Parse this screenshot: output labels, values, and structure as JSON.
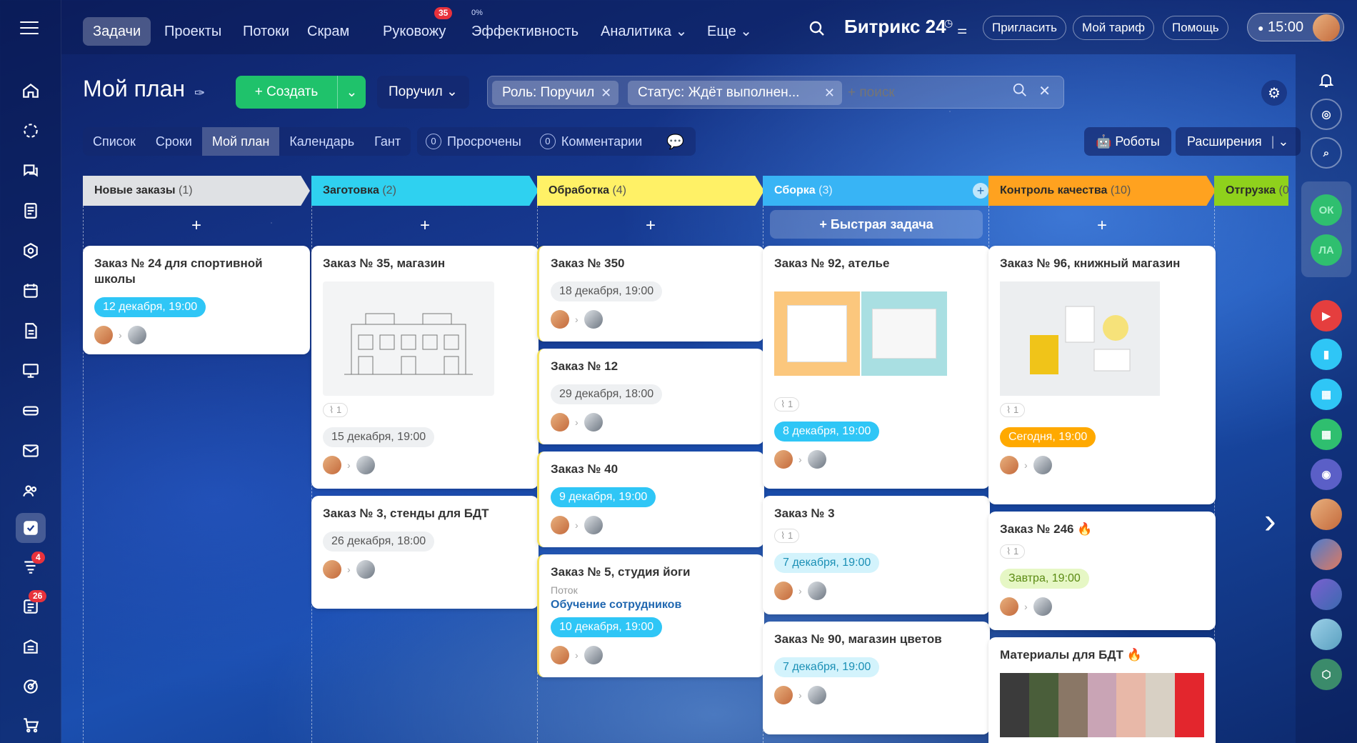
{
  "nav": {
    "items": [
      "Задачи",
      "Проекты",
      "Потоки",
      "Скрам",
      "Руковожу",
      "Эффективность",
      "Аналитика",
      "Еще"
    ],
    "badge_rukovozhu": "35",
    "efficiency_percent": "0%",
    "logo": "Битрикс 24",
    "invite": "Пригласить",
    "tariff": "Мой тариф",
    "help": "Помощь",
    "time": "15:00"
  },
  "toolbar": {
    "title": "Мой план",
    "create": "Создать",
    "role_button": "Поручил",
    "chip_role": "Роль: Поручил",
    "chip_status": "Статус: Ждёт выполнен...",
    "search_placeholder": "+ поиск",
    "robots": "Роботы",
    "extensions": "Расширения"
  },
  "tabs": [
    "Список",
    "Сроки",
    "Мой план",
    "Календарь",
    "Гант"
  ],
  "counters": {
    "overdue_count": "0",
    "overdue_label": "Просрочены",
    "comments_count": "0",
    "comments_label": "Комментарии"
  },
  "quick_task": "+ Быстрая задача",
  "sidebar_badges": {
    "streams": "4",
    "tasks": "26"
  },
  "right_sidebar": {
    "ok": "ОК",
    "la": "ЛА"
  },
  "columns": [
    {
      "name": "Новые заказы",
      "count": "(1)",
      "color": "#dfe1e4"
    },
    {
      "name": "Заготовка",
      "count": "(2)",
      "color": "#2fd1f0"
    },
    {
      "name": "Обработка",
      "count": "(4)",
      "color": "#fff166"
    },
    {
      "name": "Сборка",
      "count": "(3)",
      "color": "#38b4f5"
    },
    {
      "name": "Контроль качества",
      "count": "(10)",
      "color": "#ffa21f"
    },
    {
      "name": "Отгрузка",
      "count": "(0",
      "color": "#8fd11c"
    }
  ],
  "cards": {
    "c1": {
      "title": "Заказ № 24 для спортивной школы",
      "deadline": "12 декабря, 19:00"
    },
    "c2": {
      "title": "Заказ № 35, магазин",
      "clip": "1",
      "deadline": "15 декабря, 19:00"
    },
    "c3": {
      "title": "Заказ № 3, стенды для БДТ",
      "deadline": "26 декабря, 18:00"
    },
    "c4": {
      "title": "Заказ № 350",
      "deadline": "18 декабря, 19:00"
    },
    "c5": {
      "title": "Заказ № 12",
      "deadline": "29 декабря, 18:00"
    },
    "c6": {
      "title": "Заказ № 40",
      "deadline": "9 декабря, 19:00"
    },
    "c7": {
      "title": "Заказ № 5, студия йоги",
      "stream_label": "Поток",
      "stream": "Обучение сотрудников",
      "deadline": "10 декабря, 19:00"
    },
    "c8": {
      "title": "Заказ № 92, ателье",
      "clip": "1",
      "deadline": "8 декабря, 19:00"
    },
    "c9": {
      "title": "Заказ № 3",
      "clip": "1",
      "deadline": "7 декабря, 19:00"
    },
    "c10": {
      "title": "Заказ № 90, магазин цветов",
      "deadline": "7 декабря, 19:00"
    },
    "c11": {
      "title": "Заказ № 96, книжный магазин",
      "clip": "1",
      "deadline": "Сегодня, 19:00"
    },
    "c12": {
      "title": "Заказ № 246",
      "clip": "1",
      "deadline": "Завтра, 19:00"
    },
    "c13": {
      "title": "Материалы для БДТ"
    }
  }
}
